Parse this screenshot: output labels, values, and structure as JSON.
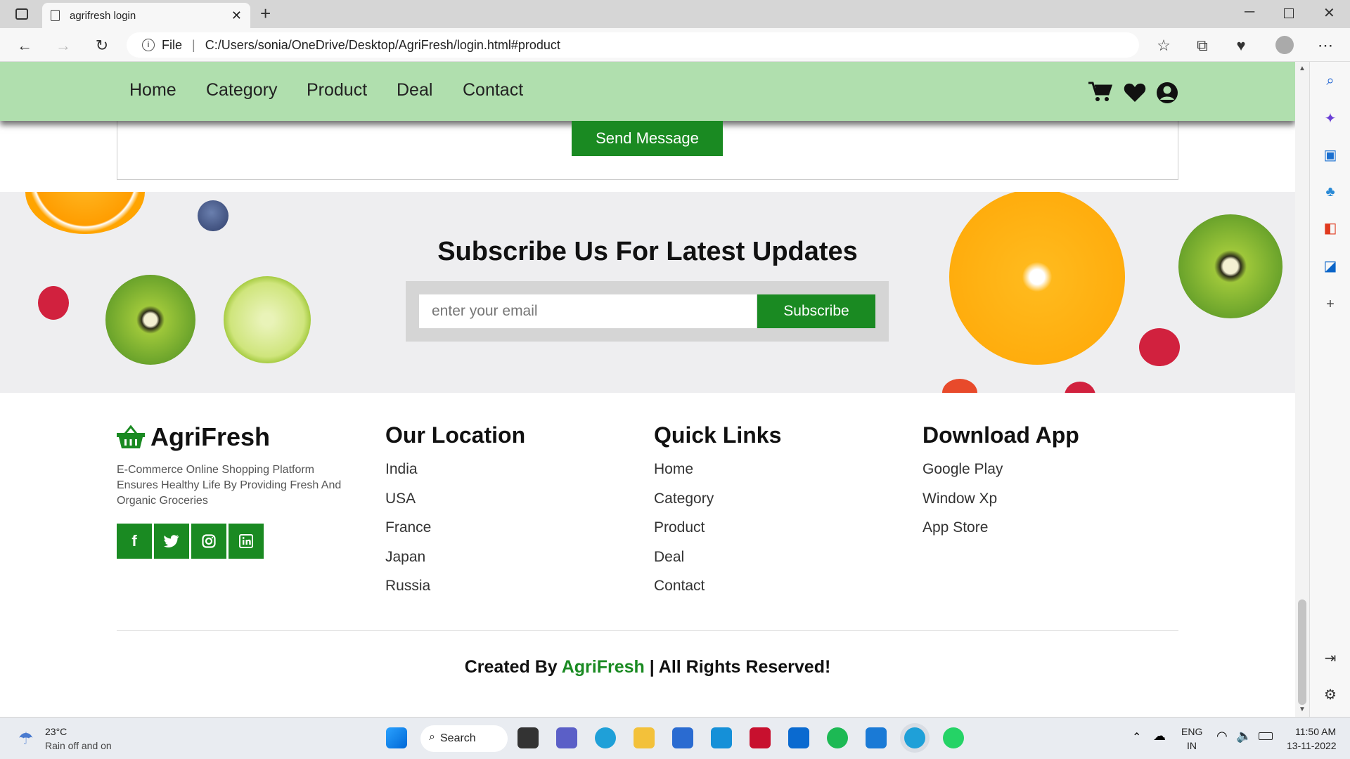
{
  "browser": {
    "tab_title": "agrifresh login",
    "url_prefix": "File",
    "url": "C:/Users/sonia/OneDrive/Desktop/AgriFresh/login.html#product"
  },
  "nav": {
    "items": [
      "Home",
      "Category",
      "Product",
      "Deal",
      "Contact"
    ]
  },
  "contact": {
    "send_label": "Send Message"
  },
  "subscribe": {
    "heading": "Subscribe Us For Latest Updates",
    "placeholder": "enter your email",
    "button": "Subscribe"
  },
  "footer": {
    "brand": "AgriFresh",
    "description": "E-Commerce Online Shopping Platform Ensures Healthy Life By Providing Fresh And Organic Groceries",
    "social": [
      "f",
      "t",
      "ig",
      "in"
    ],
    "location": {
      "title": "Our Location",
      "items": [
        "India",
        "USA",
        "France",
        "Japan",
        "Russia"
      ]
    },
    "quick": {
      "title": "Quick Links",
      "items": [
        "Home",
        "Category",
        "Product",
        "Deal",
        "Contact"
      ]
    },
    "app": {
      "title": "Download App",
      "items": [
        "Google Play",
        "Window Xp",
        "App Store"
      ]
    },
    "credit_pre": "Created By",
    "credit_brand": "AgriFresh",
    "credit_post": "| All Rights Reserved!"
  },
  "taskbar": {
    "weather_temp": "23°C",
    "weather_text": "Rain off and on",
    "search": "Search",
    "lang1": "ENG",
    "lang2": "IN",
    "time": "11:50 AM",
    "date": "13-11-2022"
  },
  "colors": {
    "nav": "#b0dfae",
    "accent": "#1a8a22"
  }
}
